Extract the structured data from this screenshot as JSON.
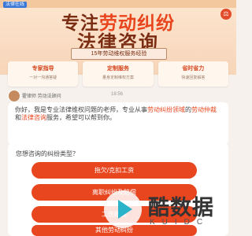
{
  "hero": {
    "brand_tag": "法律在线",
    "title_line1_pre": "专注",
    "title_line1_accent": "劳动纠纷",
    "title_line2": "法律咨询",
    "tagline": "15年劳动维权服务经验"
  },
  "features": [
    {
      "title": "专家指导",
      "sub": "一对一沟通答疑"
    },
    {
      "title": "定制服务",
      "sub": "量身定制维权方案"
    },
    {
      "title": "省时省力",
      "sub": "快速回复解答"
    }
  ],
  "advisor": {
    "name": "霍律师 劳动法顾问",
    "time": "18:56"
  },
  "bubble": {
    "part1": "你好，我是专业法律维权问题的老师，专业从事",
    "hl1": "劳动纠纷领域",
    "part2": "的",
    "hl2": "劳动仲裁",
    "part3": "和",
    "hl3": "法律咨询",
    "part4": "服务，希望可以帮到你。"
  },
  "question": {
    "text": "您想咨询的纠纷类型？",
    "options": [
      "拖欠/克扣工资",
      "离职纠纷及赔偿",
      "工伤赔偿",
      "其他劳动纠纷"
    ]
  },
  "watermark": {
    "text": "酷数据",
    "sub": "KUIDC"
  },
  "colors": {
    "accent": "#e8451d",
    "button": "#e8461f",
    "title": "#7a2d12"
  }
}
